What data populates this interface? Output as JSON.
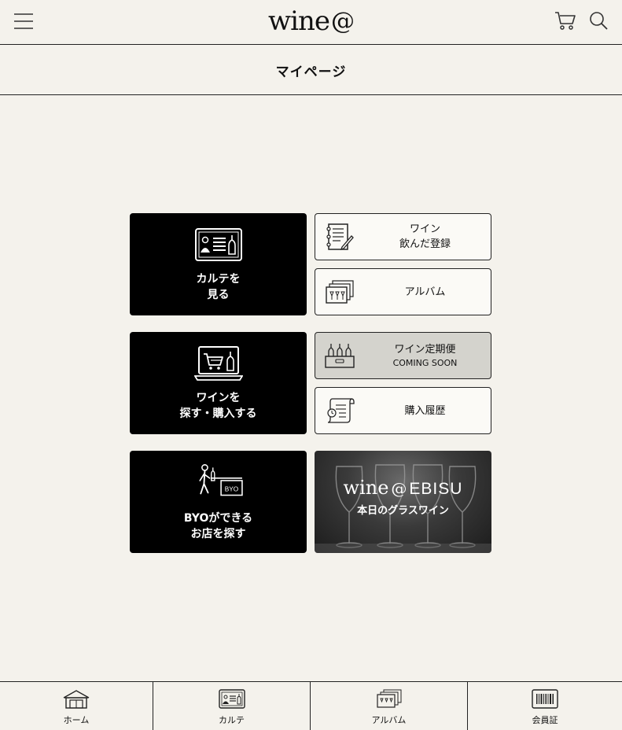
{
  "header": {
    "logo_text": "wine",
    "logo_symbol": "@"
  },
  "page": {
    "title": "マイページ"
  },
  "tiles": {
    "karte": {
      "label": "カルテを\n見る"
    },
    "wine_log": {
      "line1": "ワイン",
      "line2": "飲んだ登録"
    },
    "album": {
      "label": "アルバム"
    },
    "shop": {
      "label": "ワインを\n探す・購入する"
    },
    "subscription": {
      "line1": "ワイン定期便",
      "line2": "COMING SOON"
    },
    "history": {
      "label": "購入履歴"
    },
    "byo": {
      "label": "BYOができる\nお店を探す",
      "sign": "BYO"
    },
    "ebisu": {
      "logo_word": "wine",
      "logo_symbol": "@",
      "logo_place": "EBISU",
      "subtitle": "本日のグラスワイン"
    }
  },
  "bottom_nav": {
    "items": [
      {
        "label": "ホーム"
      },
      {
        "label": "カルテ"
      },
      {
        "label": "アルバム"
      },
      {
        "label": "会員証"
      }
    ]
  },
  "colors": {
    "background": "#f4f2ec",
    "tile_dark": "#000000",
    "tile_disabled": "#d4d3cd"
  }
}
